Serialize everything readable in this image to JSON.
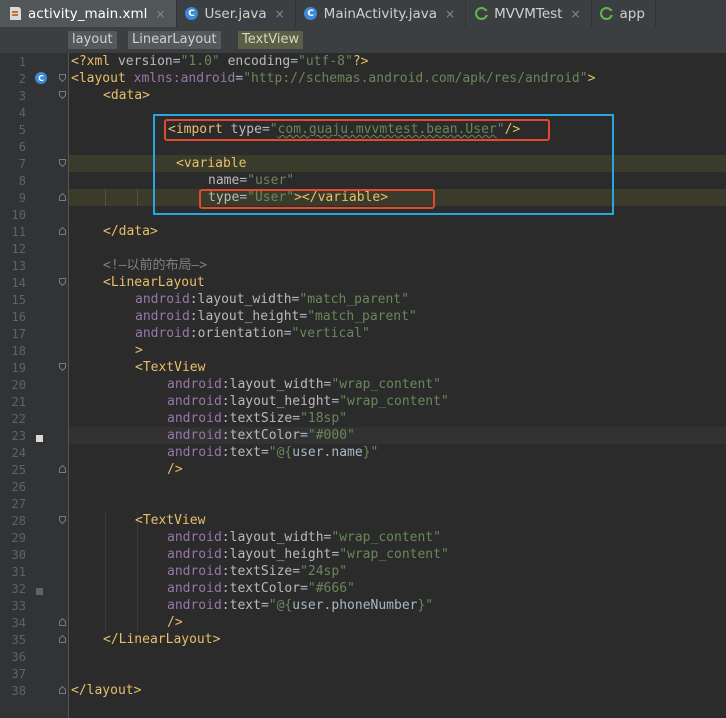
{
  "tabs": [
    {
      "label": "activity_main.xml",
      "icon": "xml-file-icon",
      "active": true,
      "closable": true
    },
    {
      "label": "User.java",
      "icon": "java-class-icon",
      "closable": true
    },
    {
      "label": "MainActivity.java",
      "icon": "java-class-icon",
      "closable": true
    },
    {
      "label": "MVVMTest",
      "icon": "android-project-icon",
      "closable": true
    },
    {
      "label": "app",
      "icon": "android-module-icon",
      "closable": false
    }
  ],
  "close_glyph": "×",
  "breadcrumbs": [
    "layout",
    "LinearLayout",
    "TextView"
  ],
  "line_numbers": [
    "1",
    "2",
    "3",
    "4",
    "5",
    "6",
    "7",
    "8",
    "9",
    "10",
    "11",
    "12",
    "13",
    "14",
    "15",
    "16",
    "17",
    "18",
    "19",
    "20",
    "21",
    "22",
    "23",
    "24",
    "25",
    "26",
    "27",
    "28",
    "29",
    "30",
    "31",
    "32",
    "33",
    "34",
    "35",
    "36",
    "37",
    "38"
  ],
  "code": {
    "l1": {
      "p1": "<?xml ",
      "a1": "version",
      "eq1": "=",
      "v1": "\"1.0\"",
      "sp": " ",
      "a2": "encoding",
      "eq2": "=",
      "v2": "\"utf-8\"",
      "p2": "?>"
    },
    "l2": {
      "open": "<layout ",
      "ns": "xmlns:android",
      "eq": "=",
      "val": "\"http://schemas.android.com/apk/res/android\"",
      "close": ">"
    },
    "l3": {
      "text": "<data>"
    },
    "l5": {
      "open": "<import ",
      "attr": "type",
      "eq": "=",
      "val_q1": "\"",
      "val": "com.guaju.mvvmtest.bean.User",
      "val_q2": "\"",
      "close": "/>"
    },
    "l7": {
      "text": "<variable"
    },
    "l8": {
      "attr": "name",
      "eq": "=",
      "val": "\"user\""
    },
    "l9": {
      "attr": "type",
      "eq": "=",
      "val": "\"User\"",
      "close": "></variable>"
    },
    "l11": {
      "text": "</data>"
    },
    "l13": {
      "text": "<!—以前的布局—>"
    },
    "l14": {
      "text": "<LinearLayout"
    },
    "l15": {
      "ns": "android",
      "attr": ":layout_width",
      "eq": "=",
      "val": "\"match_parent\""
    },
    "l16": {
      "ns": "android",
      "attr": ":layout_height",
      "eq": "=",
      "val": "\"match_parent\""
    },
    "l17": {
      "ns": "android",
      "attr": ":orientation",
      "eq": "=",
      "val": "\"vertical\""
    },
    "l18": {
      "text": ">"
    },
    "l19": {
      "text": "<TextView"
    },
    "l20": {
      "ns": "android",
      "attr": ":layout_width",
      "eq": "=",
      "val": "\"wrap_content\""
    },
    "l21": {
      "ns": "android",
      "attr": ":layout_height",
      "eq": "=",
      "val": "\"wrap_content\""
    },
    "l22": {
      "ns": "android",
      "attr": ":textSize",
      "eq": "=",
      "val": "\"18sp\""
    },
    "l23": {
      "ns": "android",
      "attr": ":textColor",
      "eq": "=",
      "val": "\"#000\""
    },
    "l24": {
      "ns": "android",
      "attr": ":text",
      "eq": "=",
      "v_open": "\"@{",
      "bind": "user.name",
      "v_close": "}\""
    },
    "l25": {
      "text": "/>"
    },
    "l28": {
      "text": "<TextView"
    },
    "l29": {
      "ns": "android",
      "attr": ":layout_width",
      "eq": "=",
      "val": "\"wrap_content\""
    },
    "l30": {
      "ns": "android",
      "attr": ":layout_height",
      "eq": "=",
      "val": "\"wrap_content\""
    },
    "l31": {
      "ns": "android",
      "attr": ":textSize",
      "eq": "=",
      "val": "\"24sp\""
    },
    "l32": {
      "ns": "android",
      "attr": ":textColor",
      "eq": "=",
      "val": "\"#666\""
    },
    "l33": {
      "ns": "android",
      "attr": ":text",
      "eq": "=",
      "v_open": "\"@{",
      "bind": "user.phoneNumber",
      "v_close": "}\""
    },
    "l34": {
      "text": "/>"
    },
    "l35": {
      "text": "</LinearLayout>"
    },
    "l38": {
      "text": "</layout>"
    }
  },
  "colors": {
    "background": "#2b2b2b",
    "tag": "#e8bf6a",
    "attribute": "#bababa",
    "namespace": "#9876aa",
    "string": "#6a8759",
    "comment": "#808080",
    "annotation_blue": "#27a6e0",
    "annotation_red": "#e24a30"
  }
}
